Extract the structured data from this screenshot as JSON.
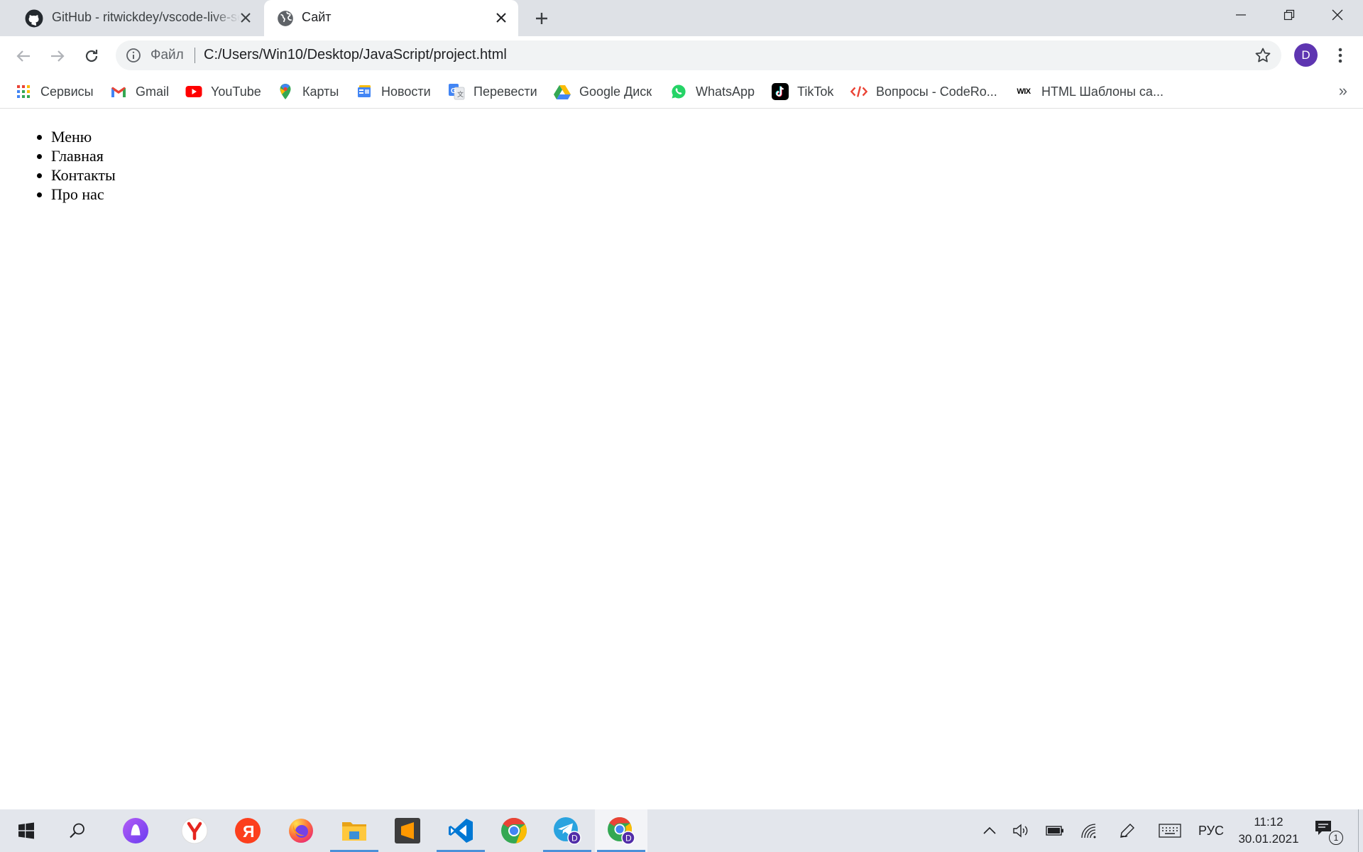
{
  "browser": {
    "tabs": [
      {
        "title": "GitHub - ritwickdey/vscode-live-server",
        "favicon": "github-icon",
        "active": false
      },
      {
        "title": "Сайт",
        "favicon": "globe-icon",
        "active": true
      }
    ],
    "address": {
      "chip": "Файл",
      "url": "C:/Users/Win10/Desktop/JavaScript/project.html"
    },
    "profile_initial": "D",
    "profile_color": "#5e35b1"
  },
  "bookmarks": [
    {
      "label": "Сервисы",
      "icon": "apps-grid-icon"
    },
    {
      "label": "Gmail",
      "icon": "gmail-icon"
    },
    {
      "label": "YouTube",
      "icon": "youtube-icon"
    },
    {
      "label": "Карты",
      "icon": "maps-pin-icon"
    },
    {
      "label": "Новости",
      "icon": "news-icon"
    },
    {
      "label": "Перевести",
      "icon": "translate-icon"
    },
    {
      "label": "Google Диск",
      "icon": "drive-icon"
    },
    {
      "label": "WhatsApp",
      "icon": "whatsapp-icon"
    },
    {
      "label": "TikTok",
      "icon": "tiktok-icon"
    },
    {
      "label": "Вопросы - CodeRo...",
      "icon": "code-icon"
    },
    {
      "label": "HTML Шаблоны са...",
      "icon": "wix-icon",
      "icon_text": "WIX"
    }
  ],
  "page": {
    "menu_items": [
      "Меню",
      "Главная",
      "Контакты",
      "Про нас"
    ]
  },
  "taskbar": {
    "language": "РУС",
    "time": "11:12",
    "date": "30.01.2021",
    "notification_count": "1",
    "avatar_initial": "D"
  }
}
